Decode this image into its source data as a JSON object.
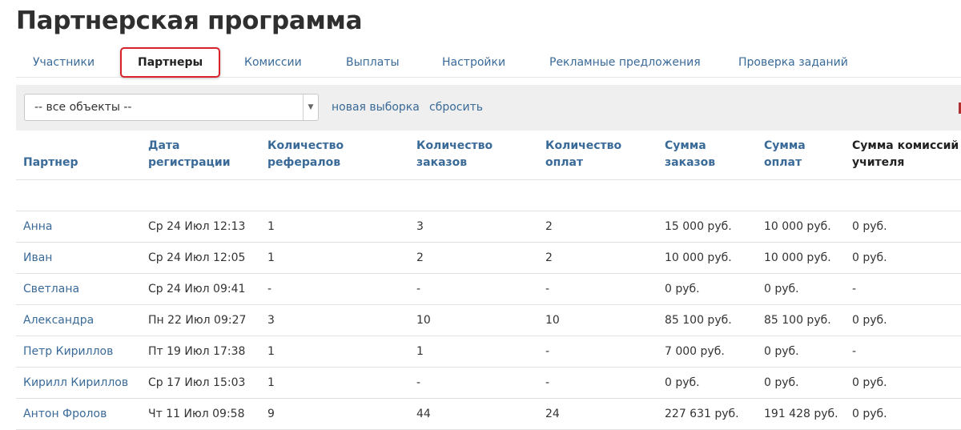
{
  "page": {
    "title": "Партнерская программа"
  },
  "tabs": [
    {
      "label": "Участники",
      "active": false
    },
    {
      "label": "Партнеры",
      "active": true
    },
    {
      "label": "Комиссии",
      "active": false
    },
    {
      "label": "Выплаты",
      "active": false
    },
    {
      "label": "Настройки",
      "active": false
    },
    {
      "label": "Рекламные предложения",
      "active": false
    },
    {
      "label": "Проверка заданий",
      "active": false
    }
  ],
  "filter": {
    "select_value": "-- все объекты --",
    "new_selection": "новая выборка",
    "reset": "сбросить"
  },
  "table": {
    "headers": [
      "Партнер",
      "Дата\nрегистрации",
      "Количество\nрефералов",
      "Количество\nзаказов",
      "Количество\nоплат",
      "Сумма\nзаказов",
      "Сумма\nоплат",
      "Сумма комиссий\nучителя"
    ],
    "rows": [
      [
        "Анна",
        "Ср 24 Июл 12:13",
        "1",
        "3",
        "2",
        "15 000 руб.",
        "10 000 руб.",
        "0 руб."
      ],
      [
        "Иван",
        "Ср 24 Июл 12:05",
        "1",
        "2",
        "2",
        "10 000 руб.",
        "10 000 руб.",
        "0 руб."
      ],
      [
        "Светлана",
        "Ср 24 Июл 09:41",
        "-",
        "-",
        "-",
        "0 руб.",
        "0 руб.",
        "-"
      ],
      [
        "Александра",
        "Пн 22 Июл 09:27",
        "3",
        "10",
        "10",
        "85 100 руб.",
        "85 100 руб.",
        "0 руб."
      ],
      [
        "Петр Кириллов",
        "Пт 19 Июл 17:38",
        "1",
        "1",
        "-",
        "7 000 руб.",
        "0 руб.",
        "-"
      ],
      [
        "Кирилл Кириллов",
        "Ср 17 Июл 15:03",
        "1",
        "-",
        "-",
        "0 руб.",
        "0 руб.",
        "0 руб."
      ],
      [
        "Антон Фролов",
        "Чт 11 Июл 09:58",
        "9",
        "44",
        "24",
        "227 631 руб.",
        "191 428 руб.",
        "0 руб."
      ]
    ]
  },
  "colors": {
    "link": "#3a6a98",
    "active_tab_border": "#d9232a",
    "filter_bar_bg": "#efefef"
  }
}
